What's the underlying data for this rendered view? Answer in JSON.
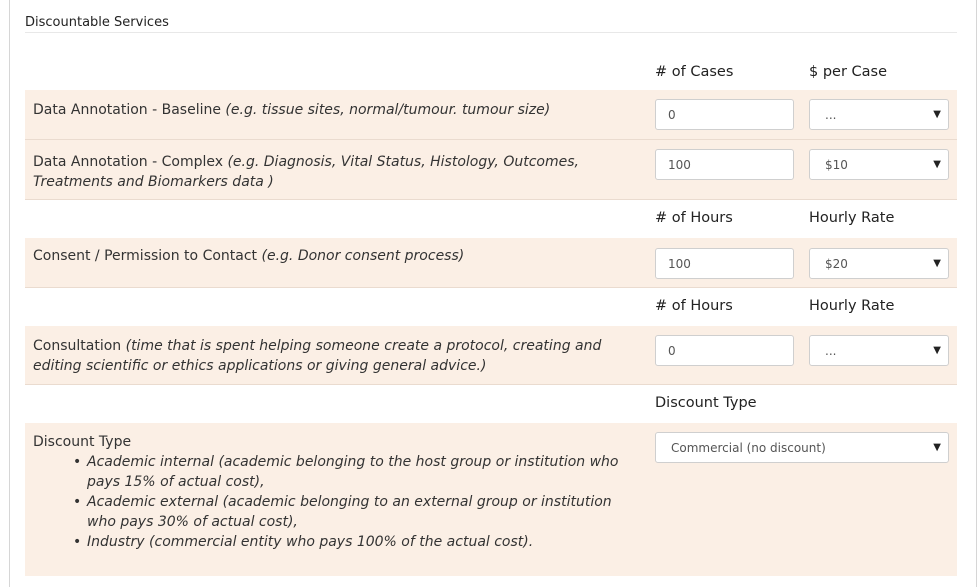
{
  "section": {
    "title": "Discountable Services"
  },
  "headers": [
    {
      "col1": "# of Cases",
      "col2": "$ per Case"
    },
    {
      "col1": "# of Hours",
      "col2": "Hourly Rate"
    },
    {
      "col1": "# of Hours",
      "col2": "Hourly Rate"
    },
    {
      "col1": "Discount Type"
    }
  ],
  "rows": [
    {
      "label": "Data Annotation - Baseline",
      "hint": "(e.g. tissue sites, normal/tumour. tumour size)",
      "quantity": "0",
      "rate": "..."
    },
    {
      "label": "Data Annotation - Complex",
      "hint": "(e.g. Diagnosis, Vital Status, Histology, Outcomes, Treatments and Biomarkers data )",
      "quantity": "100",
      "rate": "$10"
    },
    {
      "label": "Consent / Permission to Contact",
      "hint": "(e.g. Donor consent process)",
      "quantity": "100",
      "rate": "$20"
    },
    {
      "label": "Consultation",
      "hint": "(time that is spent helping someone create a protocol, creating and editing scientific or ethics applications or giving general advice.)",
      "quantity": "0",
      "rate": "..."
    }
  ],
  "discount": {
    "label": "Discount Type",
    "options": [
      "Academic internal (academic belonging to the host group or institution who pays 15% of actual cost),",
      "Academic external (academic belonging to an external group or institution who pays 30% of actual cost),",
      "Industry (commercial entity who pays 100% of the actual cost)."
    ],
    "selected": "Commercial (no discount)"
  },
  "icons": {
    "dropdown": "caret-down-icon",
    "bullet": "bullet-icon"
  },
  "colors": {
    "row_bg": "#fbefe5",
    "border": "#eadbcf"
  }
}
